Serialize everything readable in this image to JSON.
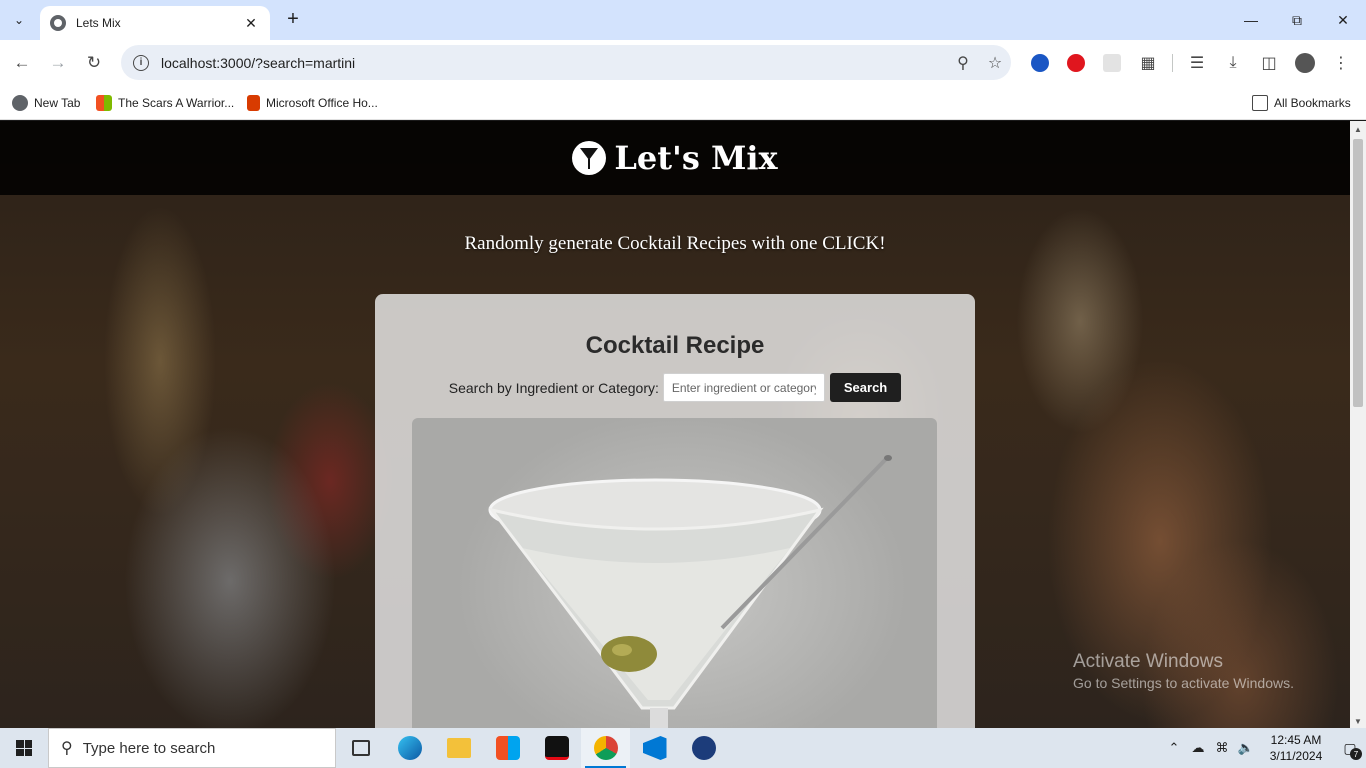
{
  "browser": {
    "tab": {
      "title": "Lets Mix"
    },
    "address_bar": {
      "url": "localhost:3000/?search=martini"
    },
    "bookmarks": [
      {
        "label": "New Tab",
        "icon": "globe-icon"
      },
      {
        "label": "The Scars A Warrior...",
        "icon": "windows-logo-icon"
      },
      {
        "label": "Microsoft Office Ho...",
        "icon": "office-icon"
      }
    ],
    "all_bookmarks_label": "All Bookmarks"
  },
  "page": {
    "brand": "Let's Mix",
    "tagline": "Randomly generate Cocktail Recipes with one CLICK!",
    "card": {
      "title": "Cocktail Recipe",
      "search_label": "Search by Ingredient or Category:",
      "search_placeholder": "Enter ingredient or category",
      "search_value": "",
      "search_button": "Search",
      "image_subject": "martini-glass-with-olive"
    }
  },
  "os": {
    "watermark_title": "Activate Windows",
    "watermark_subtitle": "Go to Settings to activate Windows.",
    "taskbar_search_placeholder": "Type here to search",
    "clock_time": "12:45 AM",
    "clock_date": "3/11/2024",
    "notification_count": "7"
  },
  "colors": {
    "tabstrip": "#d3e3fd",
    "search_button": "#1f1f1f",
    "taskbar": "#dde5ee"
  }
}
